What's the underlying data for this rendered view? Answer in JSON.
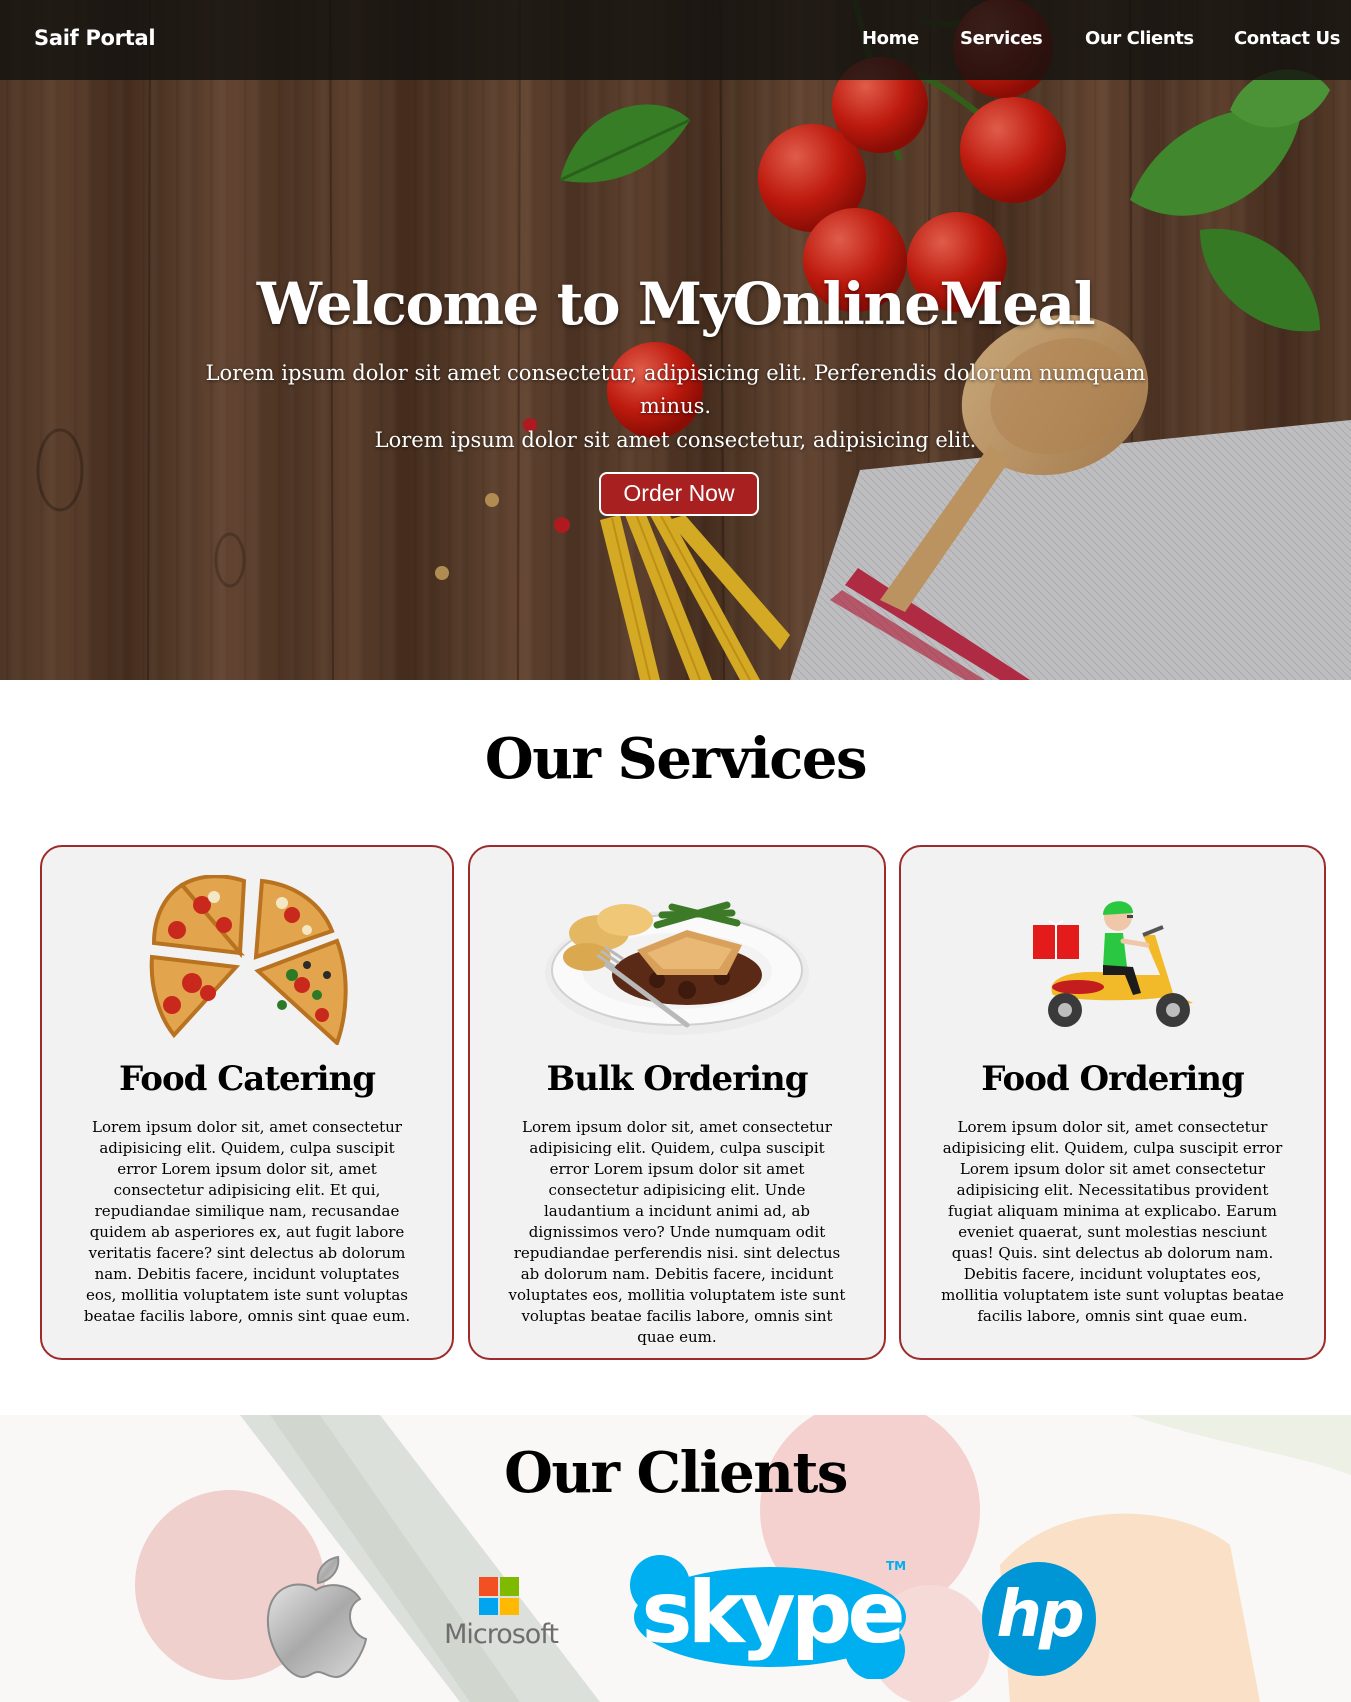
{
  "nav": {
    "brand": "Saif Portal",
    "links": [
      "Home",
      "Services",
      "Our Clients",
      "Contact Us"
    ]
  },
  "hero": {
    "title": "Welcome to MyOnlineMeal",
    "line1": "Lorem ipsum dolor sit amet consectetur, adipisicing elit. Perferendis dolorum numquam minus.",
    "line2": "Lorem ipsum dolor sit amet consectetur, adipisicing elit.",
    "button": "Order Now"
  },
  "services": {
    "title": "Our Services",
    "cards": [
      {
        "icon": "pizza-icon",
        "title": "Food Catering",
        "text": "Lorem ipsum dolor sit, amet consectetur adipisicing elit. Quidem, culpa suscipit error Lorem ipsum dolor sit, amet consectetur adipisicing elit. Et qui, repudiandae similique nam, recusandae quidem ab asperiores ex, aut fugit labore veritatis facere? sint delectus ab dolorum nam. Debitis facere, incidunt voluptates eos, mollitia voluptatem iste sunt voluptas beatae facilis labore, omnis sint quae eum."
      },
      {
        "icon": "meal-plate-icon",
        "title": "Bulk Ordering",
        "text": "Lorem ipsum dolor sit, amet consectetur adipisicing elit. Quidem, culpa suscipit error Lorem ipsum dolor sit amet consectetur adipisicing elit. Unde laudantium a incidunt animi ad, ab dignissimos vero? Unde numquam odit repudiandae perferendis nisi. sint delectus ab dolorum nam. Debitis facere, incidunt voluptates eos, mollitia voluptatem iste sunt voluptas beatae facilis labore, omnis sint quae eum."
      },
      {
        "icon": "delivery-scooter-icon",
        "title": "Food Ordering",
        "text": "Lorem ipsum dolor sit, amet consectetur adipisicing elit. Quidem, culpa suscipit error Lorem ipsum dolor sit amet consectetur adipisicing elit. Necessitatibus provident fugiat aliquam minima at explicabo. Earum eveniet quaerat, sunt molestias nesciunt quas! Quis. sint delectus ab dolorum nam. Debitis facere, incidunt voluptates eos, mollitia voluptatem iste sunt voluptas beatae facilis labore, omnis sint quae eum."
      }
    ]
  },
  "clients": {
    "title": "Our Clients",
    "logos": [
      {
        "icon": "apple-logo-icon"
      },
      {
        "icon": "microsoft-logo-icon",
        "label": "Microsoft"
      },
      {
        "icon": "skype-logo-icon",
        "label": "skype",
        "mark": "TM"
      },
      {
        "icon": "hp-logo-icon",
        "label": "hp"
      }
    ]
  },
  "colors": {
    "accent": "#a8201f",
    "card_border": "#9e2b2b",
    "card_bg": "#f2f2f2",
    "skype_blue": "#00aff0",
    "hp_blue": "#0096d6"
  }
}
